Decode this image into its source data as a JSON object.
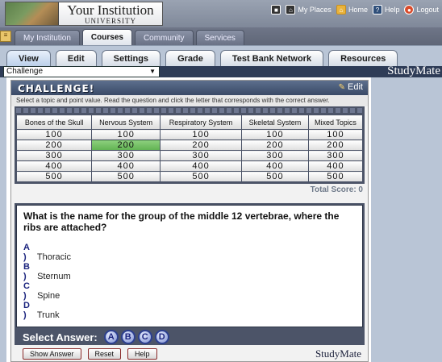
{
  "header": {
    "institution_name": "Your Institution",
    "institution_sub": "UNIVERSITY",
    "links": [
      {
        "label": "My Places",
        "icon": "places-icon"
      },
      {
        "label": "Home",
        "icon": "home-icon"
      },
      {
        "label": "Help",
        "icon": "help-icon"
      },
      {
        "label": "Logout",
        "icon": "logout-icon"
      }
    ]
  },
  "nav": {
    "tabs": [
      {
        "label": "My Institution",
        "active": false
      },
      {
        "label": "Courses",
        "active": true
      },
      {
        "label": "Community",
        "active": false
      },
      {
        "label": "Services",
        "active": false
      }
    ]
  },
  "subtabs": [
    "View",
    "Edit",
    "Settings",
    "Grade",
    "Test Bank Network",
    "Resources"
  ],
  "selector": {
    "value": "Challenge"
  },
  "brand": "StudyMate",
  "challenge": {
    "title": "CHALLENGE!",
    "edit_label": "Edit",
    "instructions": "Select a topic and point value. Read the question and click the letter that corresponds with the correct answer.",
    "categories": [
      "Bones of the Skull",
      "Nervous System",
      "Respiratory System",
      "Skeletal System",
      "Mixed Topics"
    ],
    "points": [
      "100",
      "200",
      "300",
      "400",
      "500"
    ],
    "selected": {
      "category": "Nervous System",
      "points": "200"
    },
    "total_score": "Total Score: 0",
    "question": "What is the name for the group of the middle 12 vertebrae, where the ribs are attached?",
    "options": [
      {
        "letter": "A )",
        "text": "Thoracic"
      },
      {
        "letter": "B )",
        "text": "Sternum"
      },
      {
        "letter": "C )",
        "text": "Spine"
      },
      {
        "letter": "D )",
        "text": "Trunk"
      }
    ],
    "select_answer_label": "Select Answer:",
    "answer_buttons": [
      "A",
      "B",
      "C",
      "D"
    ],
    "footer_buttons": [
      "Show Answer",
      "Reset",
      "Help"
    ]
  }
}
